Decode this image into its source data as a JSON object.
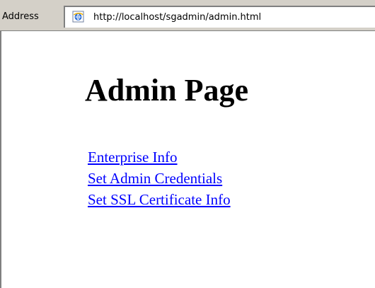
{
  "address_bar": {
    "label": "Address",
    "url": "http://localhost/sgadmin/admin.html",
    "icon": "ie-page-icon"
  },
  "page": {
    "title": "Admin Page",
    "links": [
      "Enterprise Info",
      "Set Admin Credentials",
      "Set SSL Certificate Info"
    ]
  },
  "colors": {
    "toolbar": "#d4d0c8",
    "link": "#0000ff",
    "background": "#ffffff"
  }
}
